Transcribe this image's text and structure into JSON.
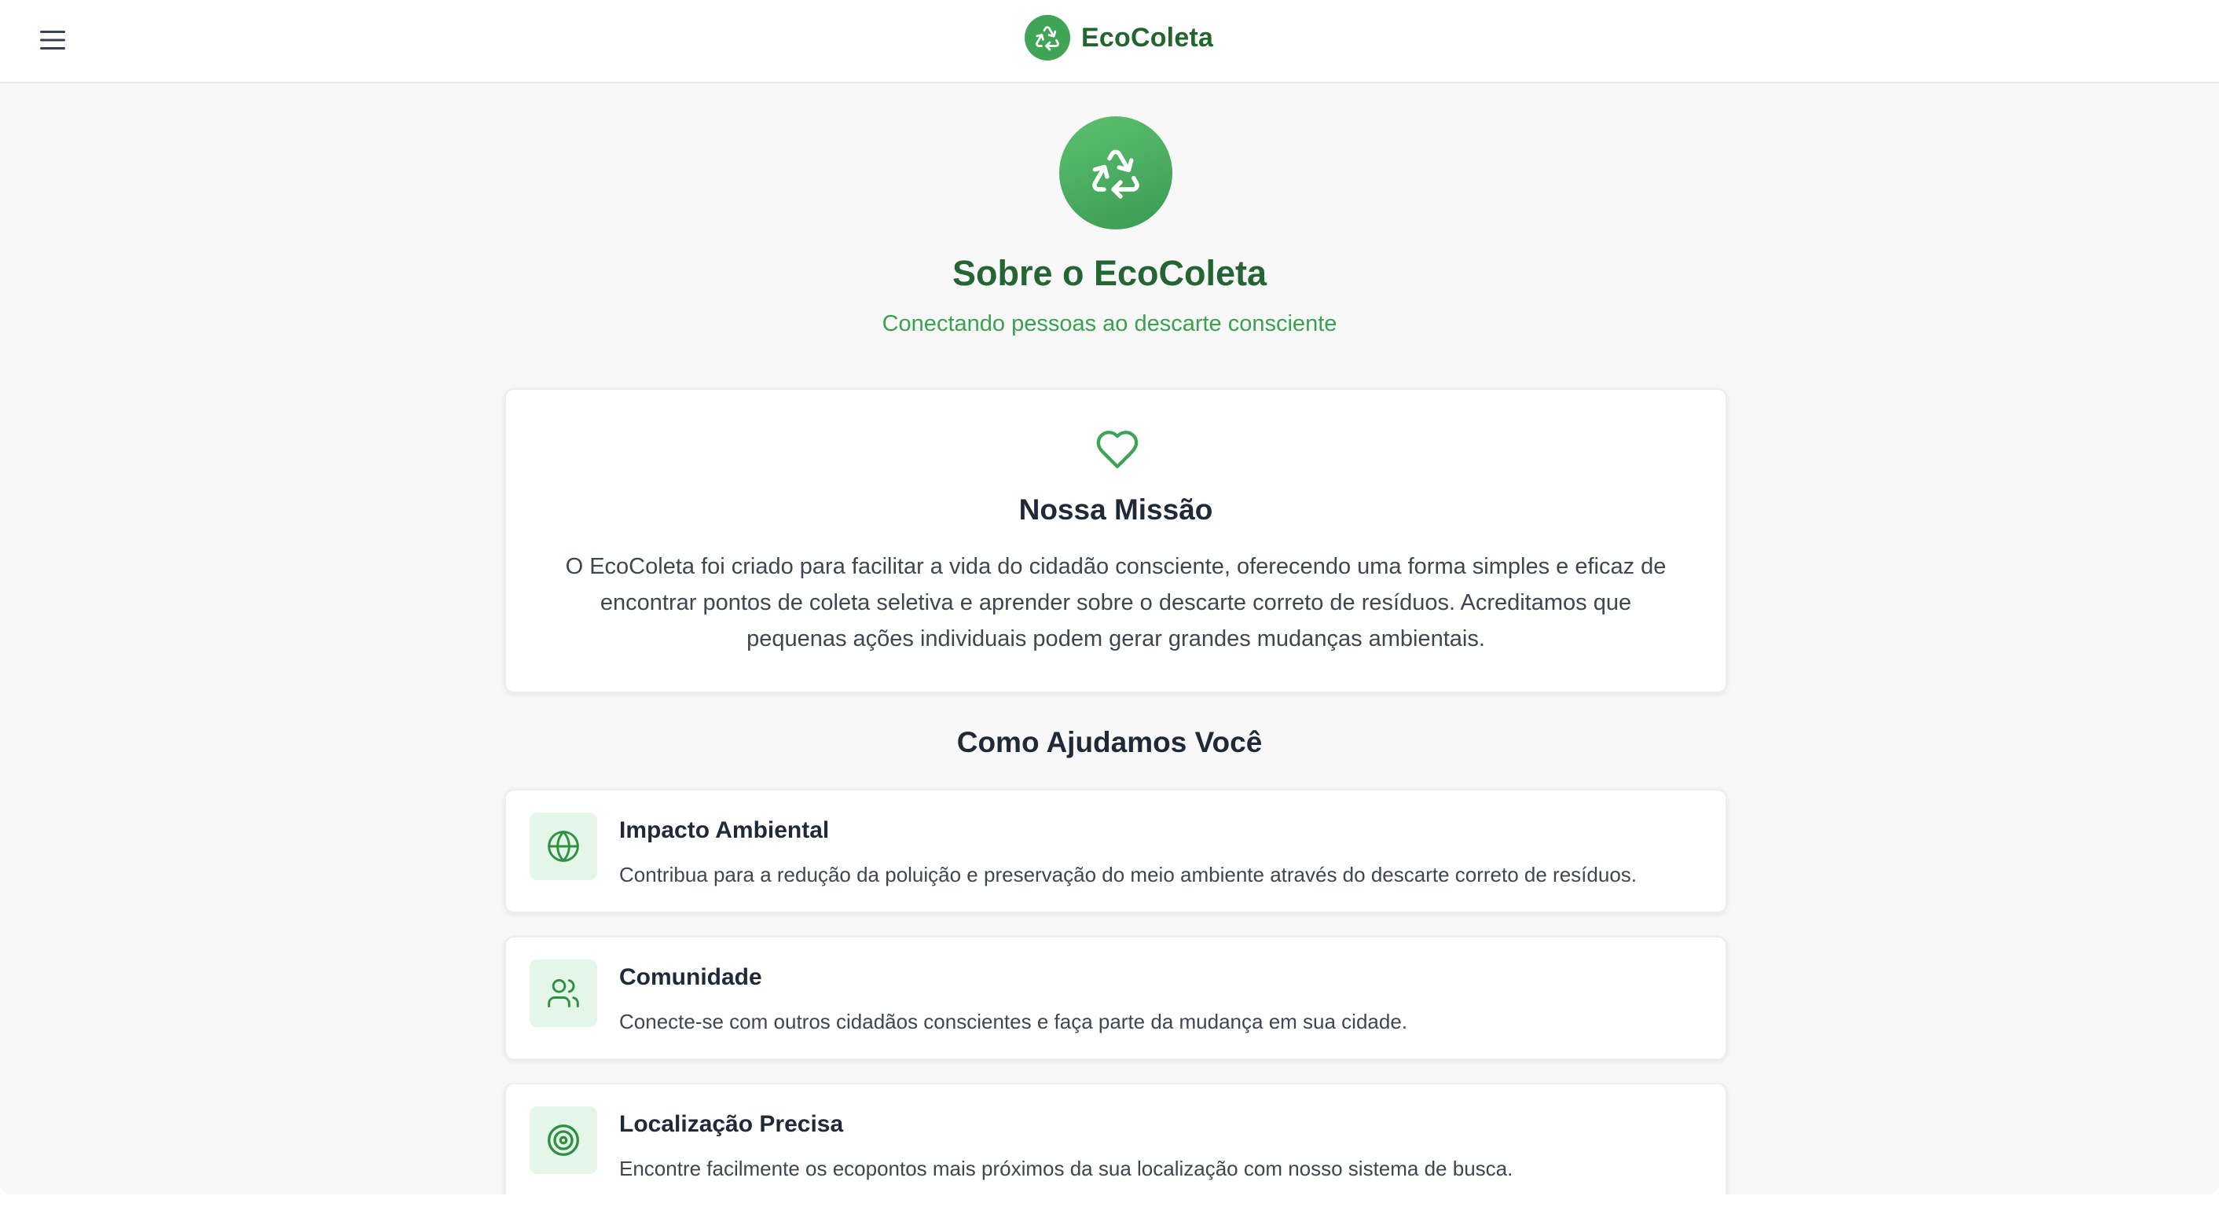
{
  "header": {
    "brand_name": "EcoColeta",
    "logo_icon": "recycle-icon",
    "menu_icon": "hamburger-menu-icon"
  },
  "hero": {
    "icon": "recycle-icon",
    "title": "Sobre o EcoColeta",
    "subtitle": "Conectando pessoas ao descarte consciente"
  },
  "mission": {
    "icon": "heart-icon",
    "title": "Nossa Missão",
    "text": "O EcoColeta foi criado para facilitar a vida do cidadão consciente, oferecendo uma forma simples e eficaz de encontrar pontos de coleta seletiva e aprender sobre o descarte correto de resíduos. Acreditamos que pequenas ações individuais podem gerar grandes mudanças ambientais."
  },
  "help_section": {
    "title": "Como Ajudamos Você",
    "features": [
      {
        "icon": "globe-icon",
        "title": "Impacto Ambiental",
        "description": "Contribua para a redução da poluição e preservação do meio ambiente através do descarte correto de resíduos."
      },
      {
        "icon": "users-icon",
        "title": "Comunidade",
        "description": "Conecte-se com outros cidadãos conscientes e faça parte da mudança em sua cidade."
      },
      {
        "icon": "target-icon",
        "title": "Localização Precisa",
        "description": "Encontre facilmente os ecopontos mais próximos da sua localização com nosso sistema de busca."
      }
    ]
  },
  "colors": {
    "brand_green": "#3fa456",
    "title_green": "#256533",
    "subtitle_green": "#3aa14f",
    "icon_tile_bg": "#e3f6e7",
    "text_dark": "#1f2937",
    "text_body": "#3f4650"
  }
}
